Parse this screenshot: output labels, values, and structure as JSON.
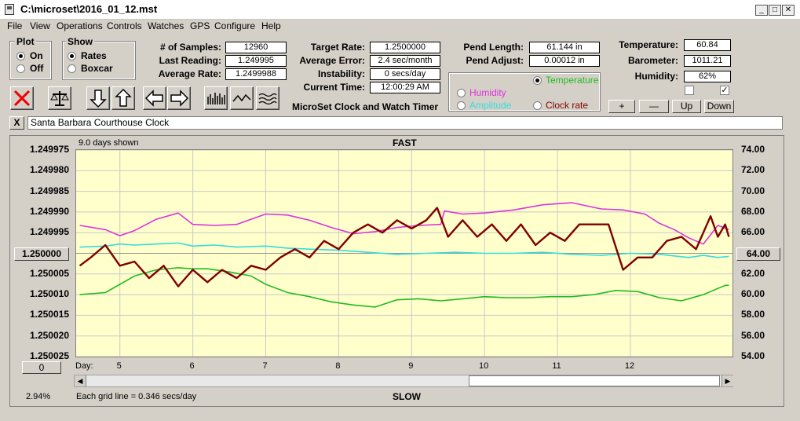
{
  "window": {
    "title": "C:\\microset\\2016_01_12.mst"
  },
  "menu": [
    "File",
    "View",
    "Operations",
    "Controls",
    "Watches",
    "GPS",
    "Configure",
    "Help"
  ],
  "plot_group": {
    "label": "Plot",
    "on": "On",
    "off": "Off"
  },
  "show_group": {
    "label": "Show",
    "rates": "Rates",
    "boxcar": "Boxcar"
  },
  "stats": {
    "samples_label": "# of Samples:",
    "samples": "12960",
    "last_label": "Last Reading:",
    "last": "1.249995",
    "avg_rate_label": "Average Rate:",
    "avg_rate": "1.2499988"
  },
  "rates": {
    "target_label": "Target Rate:",
    "target": "1.2500000",
    "avg_err_label": "Average Error:",
    "avg_err": "2.4 sec/month",
    "instab_label": "Instability:",
    "instab": "0 secs/day",
    "time_label": "Current Time:",
    "time": "12:00:29 AM"
  },
  "subtitle": "MicroSet Clock and Watch Timer",
  "pend": {
    "length_label": "Pend Length:",
    "length": "61.144 in",
    "adjust_label": "Pend Adjust:",
    "adjust": "0.00012 in"
  },
  "overlay": {
    "temperature": "Temperature",
    "humidity": "Humidity",
    "amplitude": "Amplitude",
    "clock_rate": "Clock rate"
  },
  "env": {
    "temp_label": "Temperature:",
    "temp": "60.84",
    "baro_label": "Barometer:",
    "baro": "1011.21",
    "hum_label": "Humidity:",
    "hum": "62%"
  },
  "adj_buttons": {
    "plus": "+",
    "minus": "—",
    "up": "Up",
    "down": "Down"
  },
  "clock_name": "Santa Barbara Courthouse Clock",
  "close_x": "X",
  "plot": {
    "days_shown": "9.0 days shown",
    "fast": "FAST",
    "slow": "SLOW",
    "center_left": "1.250000",
    "center_right": "64.00",
    "offset_box": "0",
    "day_label": "Day:",
    "percent": "2.94%",
    "grid_note": "Each grid line = 0.346 secs/day"
  },
  "colors": {
    "plot_bg": "#ffffcc",
    "rate": "#800000",
    "temperature": "#22bb22",
    "humidity": "#dd33dd",
    "amplitude": "#33dddd"
  },
  "chart_data": {
    "type": "line",
    "title": "",
    "x_label": "Day:",
    "xlim": [
      4.4,
      13.4
    ],
    "x_ticks": [
      5,
      6,
      7,
      8,
      9,
      10,
      11,
      12
    ],
    "y_left_ticks": [
      "1.249975",
      "1.249980",
      "1.249985",
      "1.249990",
      "1.249995",
      "1.250000",
      "1.250005",
      "1.250010",
      "1.250015",
      "1.250020",
      "1.250025"
    ],
    "y_right_ticks": [
      "74.00",
      "72.00",
      "70.00",
      "68.00",
      "66.00",
      "64.00",
      "62.00",
      "60.00",
      "58.00",
      "56.00",
      "54.00"
    ],
    "ylim_left": [
      1.249975,
      1.250025
    ],
    "ylim_right": [
      54,
      74
    ],
    "grid": true,
    "series": [
      {
        "name": "Clock rate",
        "axis": "left",
        "x": [
          4.45,
          4.6,
          4.8,
          5.0,
          5.2,
          5.4,
          5.6,
          5.8,
          6.0,
          6.2,
          6.4,
          6.6,
          6.8,
          7.0,
          7.2,
          7.4,
          7.6,
          7.8,
          8.0,
          8.2,
          8.4,
          8.6,
          8.8,
          9.0,
          9.2,
          9.35,
          9.5,
          9.7,
          9.9,
          10.1,
          10.3,
          10.5,
          10.7,
          10.9,
          11.1,
          11.3,
          11.5,
          11.7,
          11.9,
          12.1,
          12.3,
          12.5,
          12.7,
          12.9,
          13.1,
          13.2,
          13.3,
          13.35
        ],
        "values": [
          1.250003,
          1.250001,
          1.249998,
          1.250003,
          1.250002,
          1.250006,
          1.250003,
          1.250008,
          1.250004,
          1.250007,
          1.250004,
          1.250006,
          1.250003,
          1.250004,
          1.250001,
          1.249999,
          1.250001,
          1.249997,
          1.249999,
          1.249995,
          1.249993,
          1.249995,
          1.249992,
          1.249994,
          1.249992,
          1.249989,
          1.249996,
          1.249992,
          1.249996,
          1.249993,
          1.249997,
          1.249993,
          1.249998,
          1.249995,
          1.249997,
          1.249993,
          1.249993,
          1.249993,
          1.250004,
          1.250001,
          1.250001,
          1.249997,
          1.249996,
          1.249999,
          1.249991,
          1.249996,
          1.249993,
          1.249996
        ]
      },
      {
        "name": "Temperature",
        "axis": "right",
        "x": [
          4.45,
          4.8,
          5.0,
          5.2,
          5.5,
          5.8,
          6.0,
          6.2,
          6.5,
          6.8,
          7.0,
          7.3,
          7.6,
          7.9,
          8.2,
          8.5,
          8.8,
          9.1,
          9.4,
          9.7,
          10.0,
          10.3,
          10.6,
          10.9,
          11.2,
          11.5,
          11.8,
          12.1,
          12.4,
          12.7,
          13.0,
          13.3,
          13.35
        ],
        "values": [
          60.0,
          60.2,
          61.0,
          61.8,
          62.4,
          62.6,
          62.5,
          62.5,
          62.2,
          61.8,
          61.0,
          60.2,
          59.8,
          59.3,
          59.0,
          58.8,
          59.5,
          59.6,
          59.4,
          59.6,
          59.8,
          59.7,
          59.7,
          59.8,
          59.8,
          60.0,
          60.4,
          60.3,
          59.7,
          59.4,
          60.0,
          60.9,
          60.9
        ]
      },
      {
        "name": "Humidity",
        "axis": "right",
        "x": [
          4.45,
          4.8,
          5.0,
          5.2,
          5.5,
          5.8,
          6.0,
          6.3,
          6.6,
          7.0,
          7.3,
          7.6,
          7.9,
          8.2,
          8.5,
          8.8,
          9.1,
          9.4,
          9.45,
          9.7,
          10.0,
          10.4,
          10.8,
          11.2,
          11.6,
          11.9,
          12.2,
          12.4,
          12.6,
          12.8,
          13.0,
          13.2,
          13.35
        ],
        "values": [
          66.7,
          66.3,
          65.7,
          66.2,
          67.3,
          67.9,
          66.8,
          66.7,
          66.8,
          67.8,
          67.7,
          67.2,
          66.5,
          65.9,
          66.1,
          66.5,
          66.7,
          66.8,
          68.1,
          67.8,
          67.9,
          68.2,
          68.7,
          68.9,
          68.3,
          68.2,
          67.8,
          66.9,
          66.3,
          65.5,
          64.9,
          66.7,
          66.3
        ]
      },
      {
        "name": "Amplitude",
        "axis": "right",
        "x": [
          4.45,
          4.8,
          5.0,
          5.2,
          5.5,
          5.8,
          6.0,
          6.3,
          6.6,
          7.0,
          7.3,
          7.6,
          8.0,
          8.4,
          8.8,
          9.2,
          9.6,
          10.0,
          10.4,
          10.8,
          11.2,
          11.6,
          12.0,
          12.4,
          12.8,
          13.0,
          13.2,
          13.35
        ],
        "values": [
          64.6,
          64.7,
          64.9,
          64.8,
          64.9,
          65.0,
          64.7,
          64.8,
          64.6,
          64.7,
          64.5,
          64.4,
          64.3,
          64.1,
          63.9,
          64.0,
          64.1,
          64.0,
          64.0,
          64.1,
          63.9,
          63.8,
          64.0,
          63.9,
          63.6,
          63.8,
          63.6,
          63.7
        ]
      }
    ]
  }
}
